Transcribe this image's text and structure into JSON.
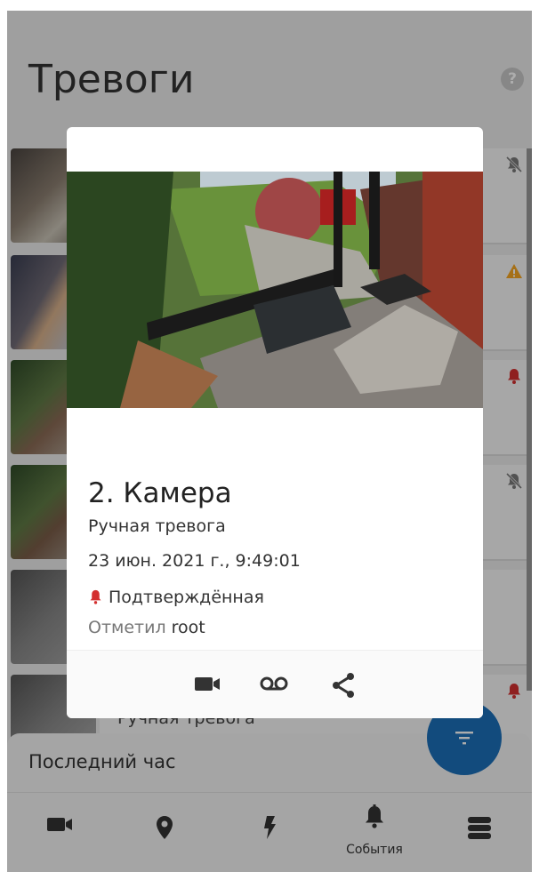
{
  "screen": {
    "title": "Тревоги",
    "help_icon": "?"
  },
  "list": {
    "visible_subtitle": "Ручная тревога"
  },
  "bottom_sheet": {
    "label": "Последний час"
  },
  "tabbar": {
    "tabs": [
      {
        "icon": "video-camera-icon",
        "label": ""
      },
      {
        "icon": "map-pin-icon",
        "label": ""
      },
      {
        "icon": "lightning-icon",
        "label": ""
      },
      {
        "icon": "bell-icon",
        "label": "События",
        "active": true
      },
      {
        "icon": "server-stack-icon",
        "label": ""
      }
    ]
  },
  "dialog": {
    "camera_title": "2. Камера",
    "alarm_type": "Ручная тревога",
    "datetime": "23 июн. 2021 г., 9:49:01",
    "state": "Подтверждённая",
    "marked_prefix": "Отметил",
    "marked_user": "root",
    "actions": [
      "video-camera-icon",
      "voicemail-icon",
      "share-icon"
    ]
  },
  "colors": {
    "accent": "#1b6fb8",
    "alarm_red": "#d32f2f",
    "warning_yellow": "#f5a623",
    "muted_bell": "#7a7a7a"
  }
}
